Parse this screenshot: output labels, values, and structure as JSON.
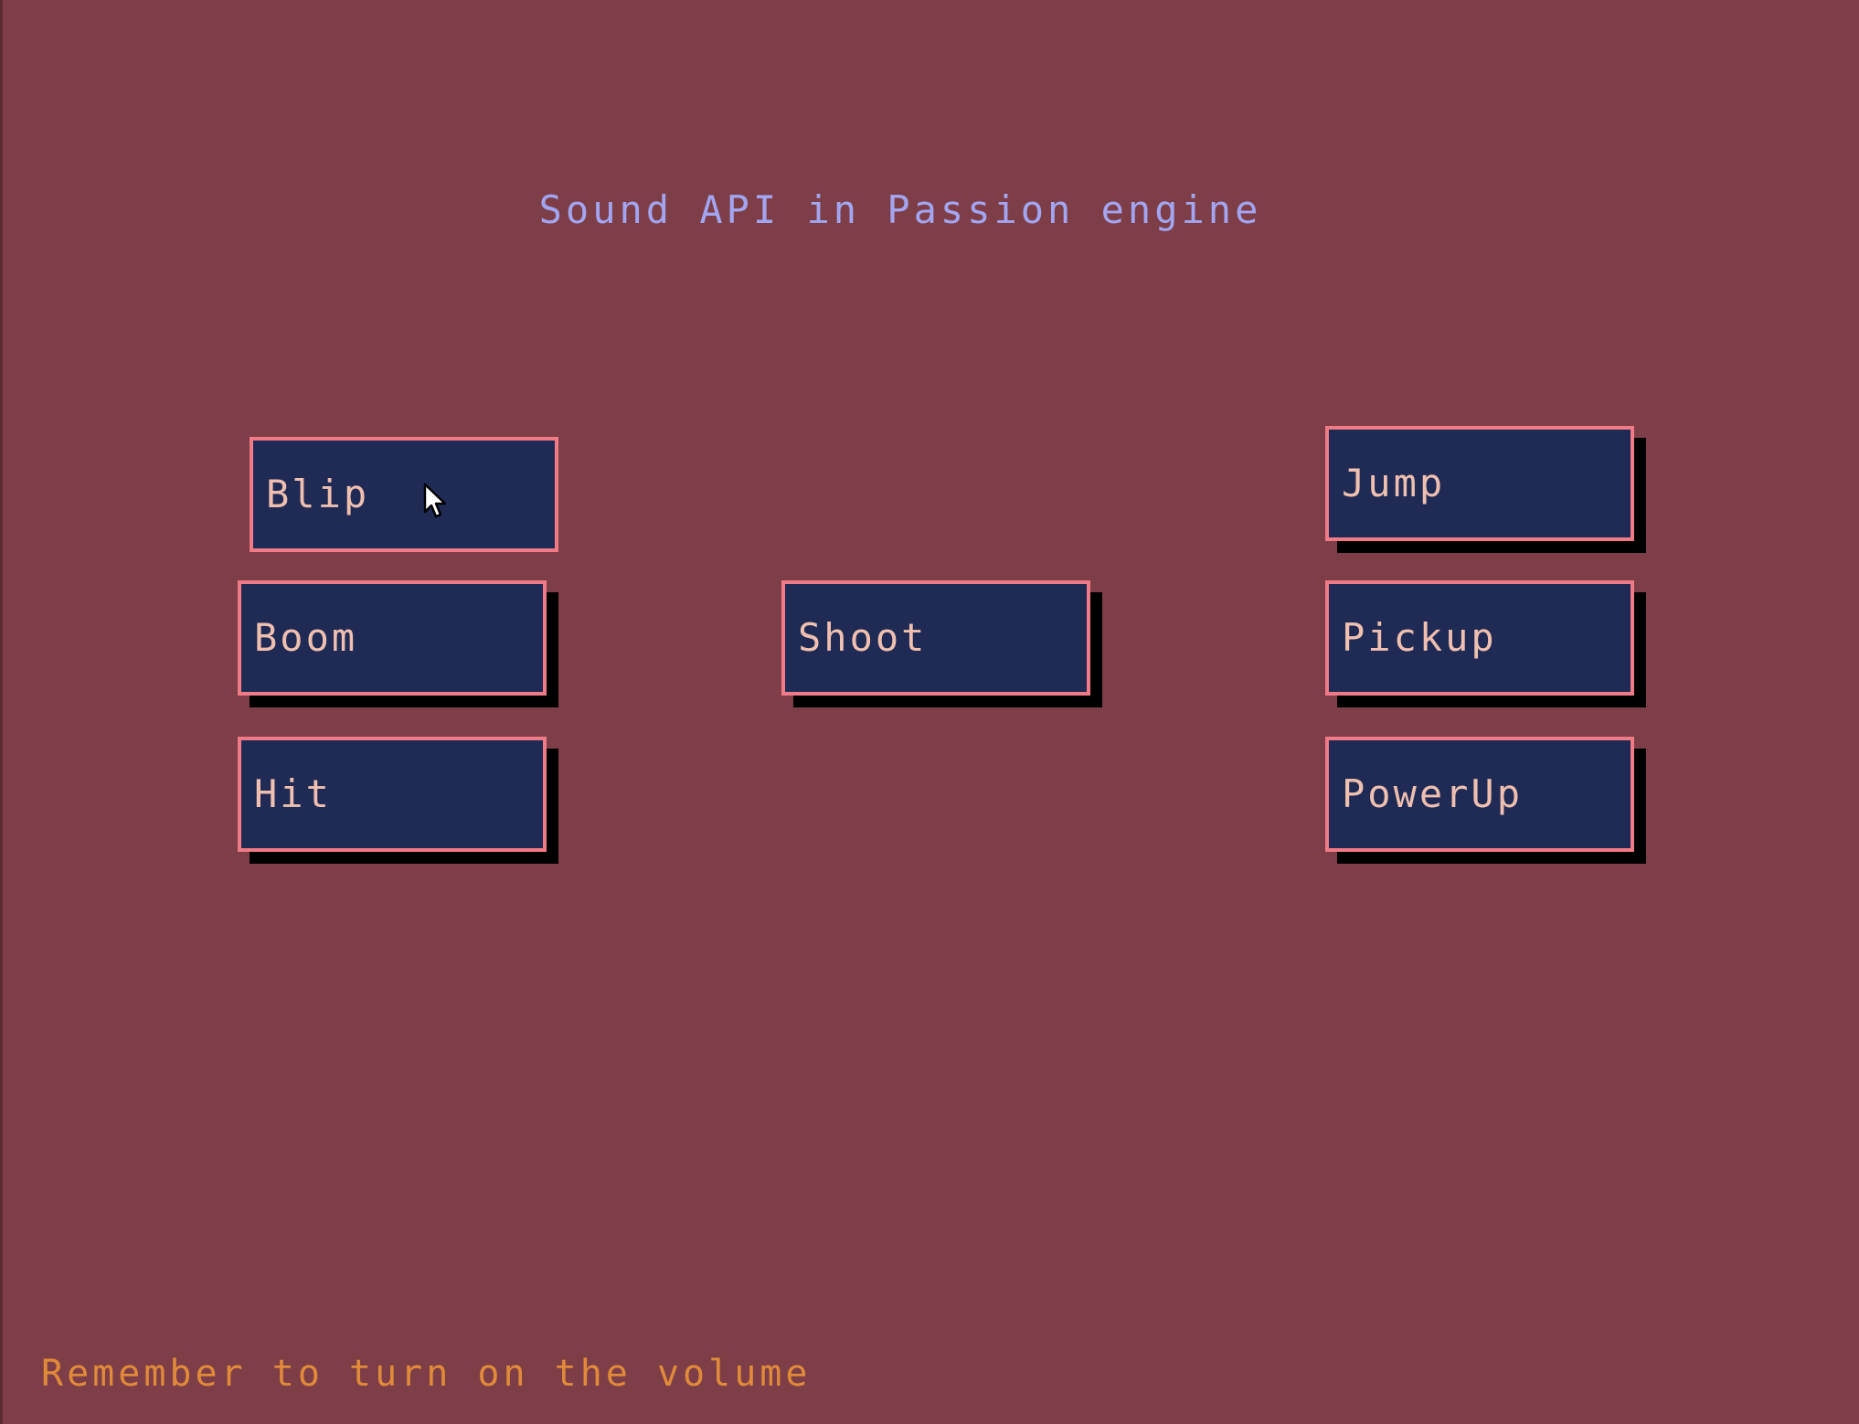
{
  "title": "Sound API in Passion engine",
  "buttons": {
    "blip": "Blip",
    "boom": "Boom",
    "hit": "Hit",
    "shoot": "Shoot",
    "jump": "Jump",
    "pickup": "Pickup",
    "powerup": "PowerUp"
  },
  "hovered_button": "Blip",
  "footer": "Remember to turn on the volume",
  "colors": {
    "background": "#7e3e47",
    "button_fill": "#1f2a55",
    "button_border": "#f07a86",
    "button_text": "#efc0b0",
    "title_text": "#a2a6f2",
    "footer_text": "#e08a3a",
    "shadow": "#000000"
  },
  "icons": {
    "cursor": "mouse-pointer-icon"
  }
}
